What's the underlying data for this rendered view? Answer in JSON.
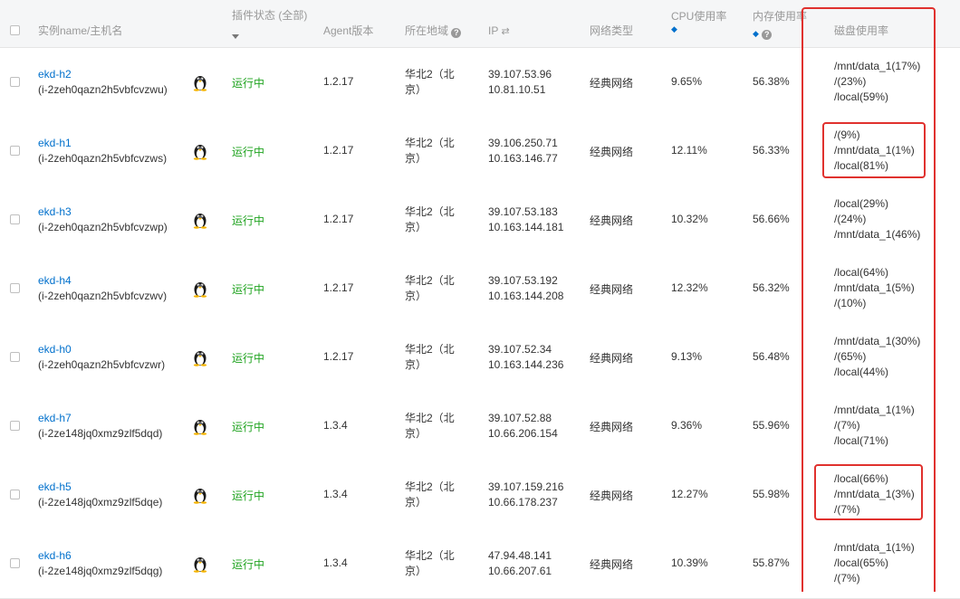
{
  "columns": {
    "name": "实例name/主机名",
    "plugin_status": "插件状态 (全部)",
    "agent": "Agent版本",
    "region": "所在地域",
    "ip": "IP",
    "network": "网络类型",
    "cpu": "CPU使用率",
    "mem": "内存使用率",
    "disk": "磁盘使用率"
  },
  "rows": [
    {
      "name": "ekd-h2",
      "id": "(i-2zeh0qazn2h5vbfcvzwu)",
      "status": "运行中",
      "agent": "1.2.17",
      "region_l1": "华北2（北",
      "region_l2": "京）",
      "ip1": "39.107.53.96",
      "ip2": "10.81.10.51",
      "network": "经典网络",
      "cpu": "9.65%",
      "mem": "56.38%",
      "disk": [
        "/mnt/data_1(17%)",
        "/(23%)",
        "/local(59%)"
      ]
    },
    {
      "name": "ekd-h1",
      "id": "(i-2zeh0qazn2h5vbfcvzws)",
      "status": "运行中",
      "agent": "1.2.17",
      "region_l1": "华北2（北",
      "region_l2": "京）",
      "ip1": "39.106.250.71",
      "ip2": "10.163.146.77",
      "network": "经典网络",
      "cpu": "12.11%",
      "mem": "56.33%",
      "disk": [
        "/(9%)",
        "/mnt/data_1(1%)",
        "/local(81%)"
      ]
    },
    {
      "name": "ekd-h3",
      "id": "(i-2zeh0qazn2h5vbfcvzwp)",
      "status": "运行中",
      "agent": "1.2.17",
      "region_l1": "华北2（北",
      "region_l2": "京）",
      "ip1": "39.107.53.183",
      "ip2": "10.163.144.181",
      "network": "经典网络",
      "cpu": "10.32%",
      "mem": "56.66%",
      "disk": [
        "/local(29%)",
        "/(24%)",
        "/mnt/data_1(46%)"
      ]
    },
    {
      "name": "ekd-h4",
      "id": "(i-2zeh0qazn2h5vbfcvzwv)",
      "status": "运行中",
      "agent": "1.2.17",
      "region_l1": "华北2（北",
      "region_l2": "京）",
      "ip1": "39.107.53.192",
      "ip2": "10.163.144.208",
      "network": "经典网络",
      "cpu": "12.32%",
      "mem": "56.32%",
      "disk": [
        "/local(64%)",
        "/mnt/data_1(5%)",
        "/(10%)"
      ]
    },
    {
      "name": "ekd-h0",
      "id": "(i-2zeh0qazn2h5vbfcvzwr)",
      "status": "运行中",
      "agent": "1.2.17",
      "region_l1": "华北2（北",
      "region_l2": "京）",
      "ip1": "39.107.52.34",
      "ip2": "10.163.144.236",
      "network": "经典网络",
      "cpu": "9.13%",
      "mem": "56.48%",
      "disk": [
        "/mnt/data_1(30%)",
        "/(65%)",
        "/local(44%)"
      ]
    },
    {
      "name": "ekd-h7",
      "id": "(i-2ze148jq0xmz9zlf5dqd)",
      "status": "运行中",
      "agent": "1.3.4",
      "region_l1": "华北2（北",
      "region_l2": "京）",
      "ip1": "39.107.52.88",
      "ip2": "10.66.206.154",
      "network": "经典网络",
      "cpu": "9.36%",
      "mem": "55.96%",
      "disk": [
        "/mnt/data_1(1%)",
        "/(7%)",
        "/local(71%)"
      ]
    },
    {
      "name": "ekd-h5",
      "id": "(i-2ze148jq0xmz9zlf5dqe)",
      "status": "运行中",
      "agent": "1.3.4",
      "region_l1": "华北2（北",
      "region_l2": "京）",
      "ip1": "39.107.159.216",
      "ip2": "10.66.178.237",
      "network": "经典网络",
      "cpu": "12.27%",
      "mem": "55.98%",
      "disk": [
        "/local(66%)",
        "/mnt/data_1(3%)",
        "/(7%)"
      ]
    },
    {
      "name": "ekd-h6",
      "id": "(i-2ze148jq0xmz9zlf5dqg)",
      "status": "运行中",
      "agent": "1.3.4",
      "region_l1": "华北2（北",
      "region_l2": "京）",
      "ip1": "47.94.48.141",
      "ip2": "10.66.207.61",
      "network": "经典网络",
      "cpu": "10.39%",
      "mem": "55.87%",
      "disk": [
        "/mnt/data_1(1%)",
        "/local(65%)",
        "/(7%)"
      ]
    }
  ],
  "icons": {
    "os": "linux-penguin-icon",
    "swap": "swap-arrows-icon",
    "help": "question-circle-icon",
    "dropdown": "caret-down-icon",
    "sort": "sort-diamond-icon"
  },
  "colors": {
    "link": "#0070cc",
    "running": "#1fa31f",
    "highlight": "#e0312e",
    "header_bg": "#f5f6f7"
  }
}
